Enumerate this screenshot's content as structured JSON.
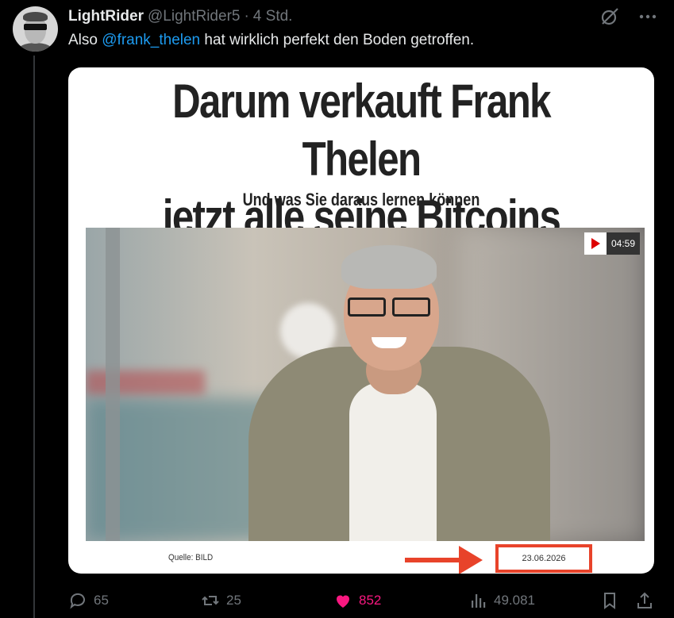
{
  "tweet": {
    "display_name": "LightRider",
    "handle": "@LightRider5",
    "separator": "·",
    "time": "4 Std.",
    "text_before": "Also ",
    "mention": "@frank_thelen",
    "text_after": " hat wirklich perfekt den Boden getroffen."
  },
  "card": {
    "headline_line1": "Darum verkauft Frank Thelen",
    "headline_line2": "jetzt alle seine Bitcoins",
    "subheadline": "Und was Sie daraus lernen können",
    "video_duration": "04:59",
    "source": "Quelle: BILD",
    "date": "23.06.2026"
  },
  "actions": {
    "replies": "65",
    "retweets": "25",
    "likes": "852",
    "views": "49.081"
  },
  "colors": {
    "background": "#000000",
    "text": "#e7e9ea",
    "muted": "#71767b",
    "mention": "#1d9bf0",
    "like": "#f91880",
    "annotation": "#e8432a"
  },
  "icons": [
    "grok-icon",
    "more-icon",
    "reply-icon",
    "retweet-icon",
    "heart-icon",
    "views-icon",
    "bookmark-icon",
    "share-icon",
    "play-icon"
  ]
}
